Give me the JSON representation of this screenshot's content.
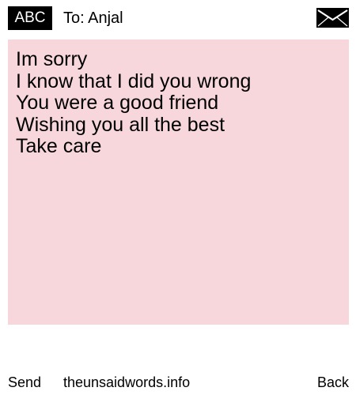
{
  "header": {
    "input_mode": "ABC",
    "recipient": "To: Anjal",
    "envelope_icon": "envelope-icon"
  },
  "message": {
    "lines": [
      "Im sorry",
      "I know that I did you wrong",
      "You were a good friend",
      "Wishing you all the best",
      "Take care"
    ],
    "background_color": "#f8d7dc"
  },
  "footer": {
    "send_label": "Send",
    "site_label": "theunsaidwords.info",
    "back_label": "Back"
  }
}
